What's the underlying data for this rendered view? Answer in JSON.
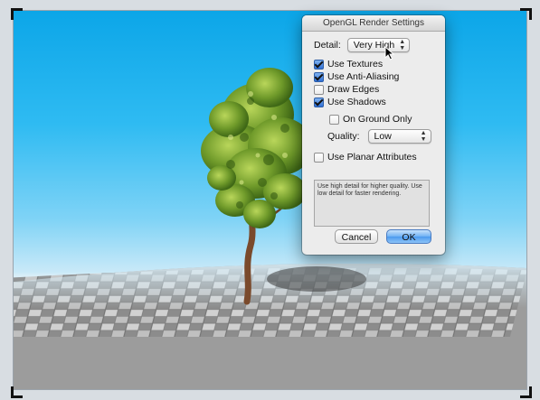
{
  "dialog": {
    "title": "OpenGL Render Settings",
    "detail": {
      "label": "Detail:",
      "value": "Very High"
    },
    "options": {
      "use_textures": {
        "label": "Use Textures",
        "checked": true
      },
      "use_anti_aliasing": {
        "label": "Use Anti-Aliasing",
        "checked": true
      },
      "draw_edges": {
        "label": "Draw Edges",
        "checked": false
      },
      "use_shadows": {
        "label": "Use Shadows",
        "checked": true
      },
      "on_ground_only": {
        "label": "On Ground Only",
        "checked": false
      },
      "use_planar_attributes": {
        "label": "Use Planar Attributes",
        "checked": false
      }
    },
    "quality": {
      "label": "Quality:",
      "value": "Low"
    },
    "help_text": "Use high detail for higher quality. Use low detail for faster rendering.",
    "buttons": {
      "cancel": "Cancel",
      "ok": "OK"
    }
  },
  "scene": {
    "sky_colors": [
      "#0ca6e8",
      "#d9eef8"
    ],
    "tree": "tree-model",
    "ground": "checkered-ground-plane"
  }
}
